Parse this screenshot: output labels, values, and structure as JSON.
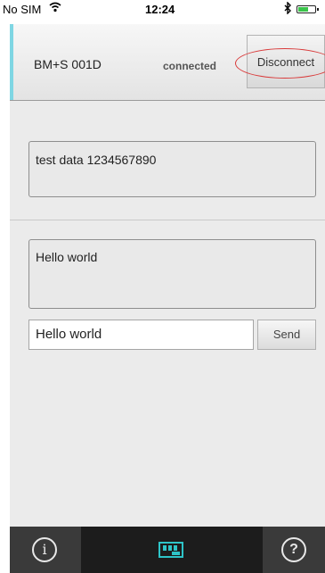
{
  "status_bar": {
    "carrier": "No SIM",
    "wifi_icon": "wifi-icon",
    "time": "12:24",
    "bluetooth_icon": "bluetooth-icon",
    "battery_icon": "battery-icon",
    "battery_level": 0.6
  },
  "header": {
    "device_name": "BM+S 001D",
    "connection_state": "connected",
    "disconnect_label": "Disconnect",
    "accent_color": "#7fd6e3",
    "highlight_color": "#d93a3a"
  },
  "main": {
    "received_text": "test data 1234567890",
    "sent_log_text": "Hello world",
    "message_input_value": "Hello world",
    "send_label": "Send"
  },
  "tab_bar": {
    "tabs": [
      {
        "icon": "info-icon",
        "glyph": "i"
      },
      {
        "icon": "circuit-board-icon"
      },
      {
        "icon": "help-icon",
        "glyph": "?"
      }
    ],
    "board_icon_color": "#2ec4c8"
  }
}
